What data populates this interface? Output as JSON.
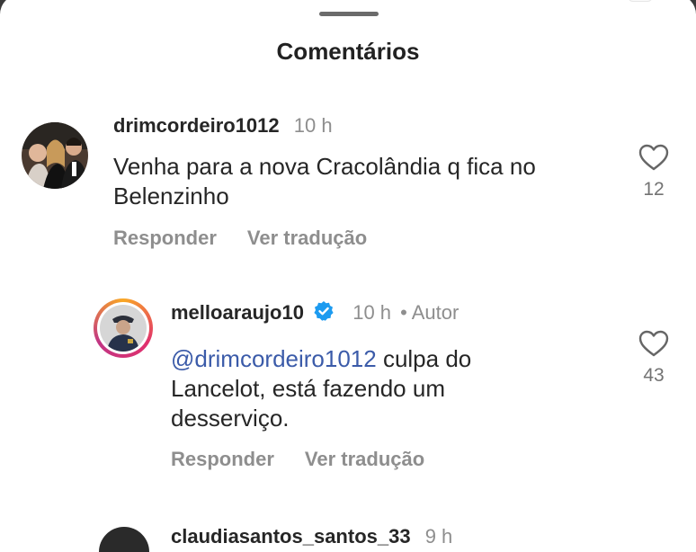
{
  "sheet": {
    "title": "Comentários"
  },
  "comments": [
    {
      "username": "drimcordeiro1012",
      "time": "10 h",
      "text_line1": "Venha para a nova Cracolândia q fica no",
      "text_line2": "Belenzinho",
      "reply_label": "Responder",
      "translate_label": "Ver tradução",
      "likes": "12",
      "avatar_icon": "group-photo-avatar"
    },
    {
      "username": "melloaraujo10",
      "verified": true,
      "time": "10 h",
      "author_label": "• Autor",
      "mention": "@drimcordeiro1012",
      "text_line1_rest": " culpa do",
      "text_line2": "Lancelot, está fazendo um",
      "text_line3": "desserviço.",
      "reply_label": "Responder",
      "translate_label": "Ver tradução",
      "likes": "43",
      "avatar_icon": "police-officer-avatar"
    },
    {
      "username": "claudiasantos_santos_33",
      "time": "9 h"
    }
  ],
  "colors": {
    "mention": "#3b5ba9",
    "verified": "#1d9bf0",
    "story_ring": [
      "#f9a825",
      "#e1306c",
      "#c13584"
    ]
  }
}
